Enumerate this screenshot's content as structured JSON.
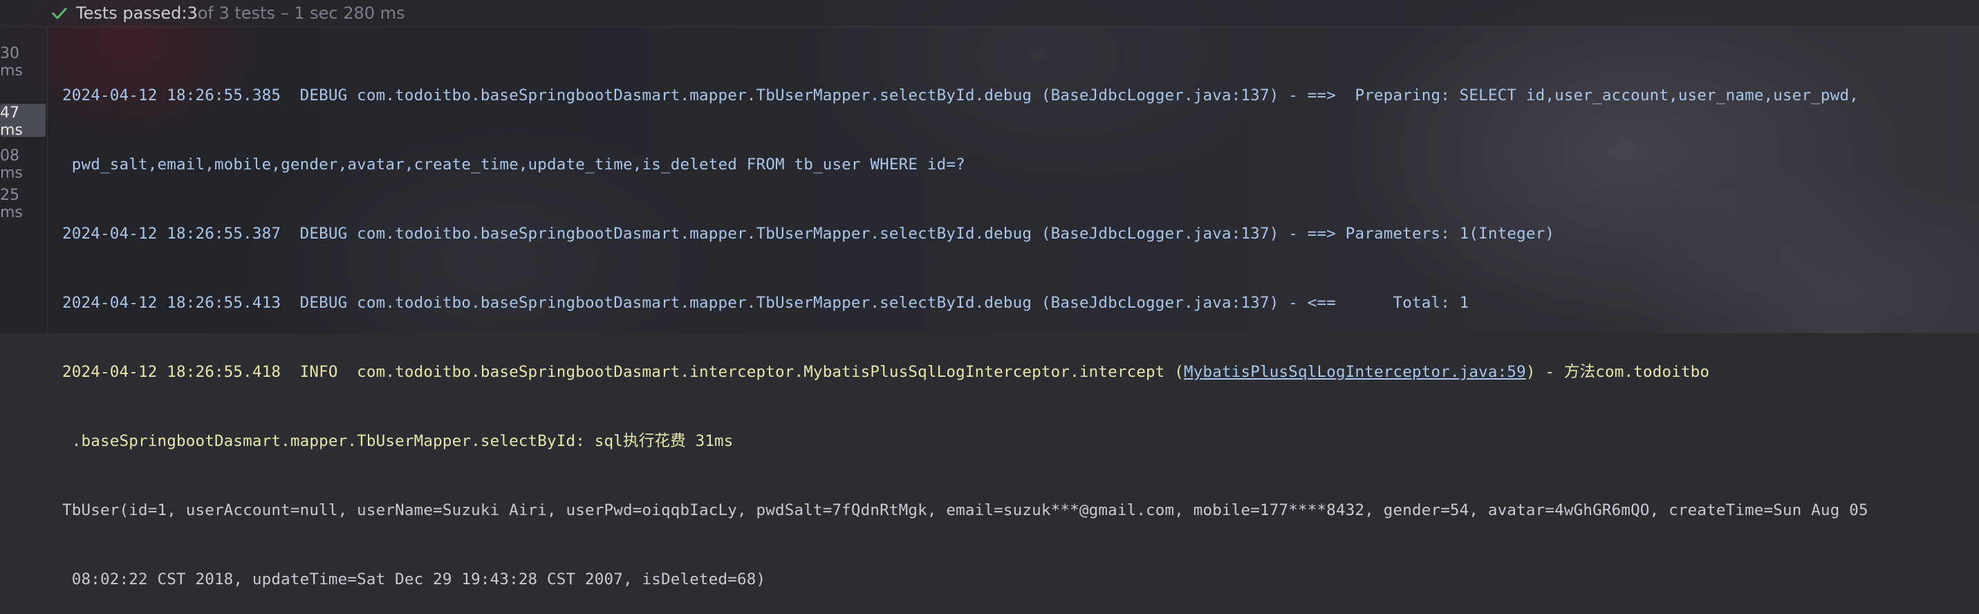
{
  "status": {
    "passed_label": "Tests passed: ",
    "passed_count": "3",
    "suffix": " of 3 tests – 1 sec 280 ms"
  },
  "gutter": {
    "times": [
      "30 ms",
      "47 ms",
      "08 ms",
      "25 ms"
    ],
    "selected_index": 1
  },
  "console": {
    "lines": [
      "2024-04-12 18:26:55.385  DEBUG com.todoitbo.baseSpringbootDasmart.mapper.TbUserMapper.selectById.debug (BaseJdbcLogger.java:137) - ==>  Preparing: SELECT id,user_account,user_name,user_pwd,",
      " pwd_salt,email,mobile,gender,avatar,create_time,update_time,is_deleted FROM tb_user WHERE id=?",
      "2024-04-12 18:26:55.387  DEBUG com.todoitbo.baseSpringbootDasmart.mapper.TbUserMapper.selectById.debug (BaseJdbcLogger.java:137) - ==> Parameters: 1(Integer)",
      "2024-04-12 18:26:55.413  DEBUG com.todoitbo.baseSpringbootDasmart.mapper.TbUserMapper.selectById.debug (BaseJdbcLogger.java:137) - <==      Total: 1",
      {
        "prefix": "2024-04-12 18:26:55.418  INFO  com.todoitbo.baseSpringbootDasmart.interceptor.MybatisPlusSqlLogInterceptor.intercept (",
        "link": "MybatisPlusSqlLogInterceptor.java:59",
        "suffix": ") - 方法com.todoitbo"
      },
      " .baseSpringbootDasmart.mapper.TbUserMapper.selectById: sql执行花费 31ms",
      "TbUser(id=1, userAccount=null, userName=Suzuki Airi, userPwd=oiqqbIacLy, pwdSalt=7fQdnRtMgk, email=suzuk***@gmail.com, mobile=177****8432, gender=54, avatar=4wGhGR6mQO, createTime=Sun Aug 05",
      " 08:02:22 CST 2018, updateTime=Sat Dec 29 19:43:28 CST 2007, isDeleted=68)"
    ]
  },
  "colors": {
    "debug": "#a9c6e8",
    "info": "#e9e6a8",
    "plain": "#c8cbd1",
    "pass_check": "#5fb36b"
  },
  "icons": {
    "status": "check-icon"
  }
}
